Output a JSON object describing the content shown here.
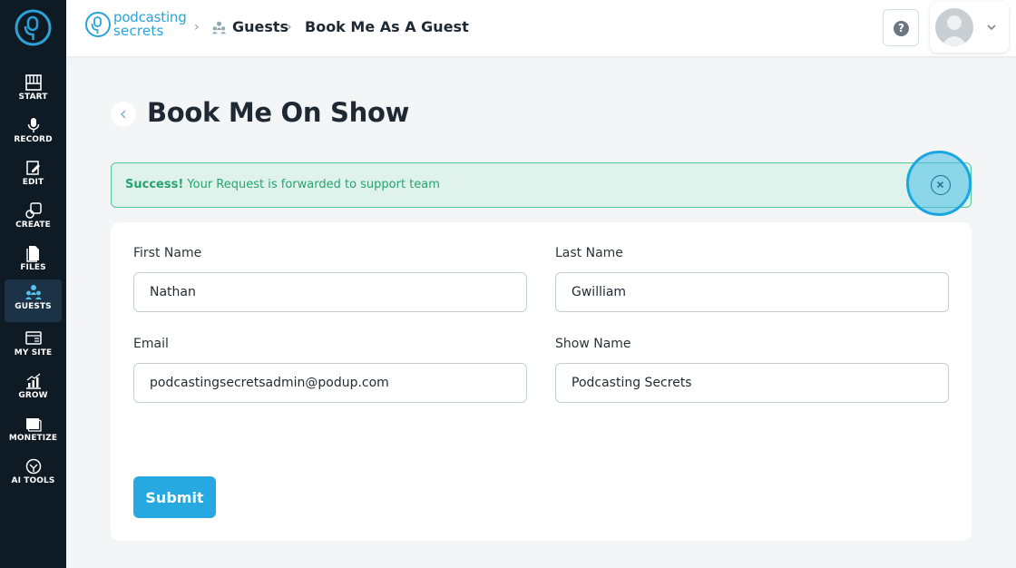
{
  "sidebar": {
    "items": [
      {
        "label": "START",
        "icon": "piano-icon"
      },
      {
        "label": "RECORD",
        "icon": "microphone-icon"
      },
      {
        "label": "EDIT",
        "icon": "edit-icon"
      },
      {
        "label": "CREATE",
        "icon": "create-icon"
      },
      {
        "label": "FILES",
        "icon": "files-icon"
      },
      {
        "label": "GUESTS",
        "icon": "guests-icon",
        "active": true
      },
      {
        "label": "MY SITE",
        "icon": "site-icon"
      },
      {
        "label": "GROW",
        "icon": "chart-icon"
      },
      {
        "label": "MONETIZE",
        "icon": "monetize-icon"
      },
      {
        "label": "AI TOOLS",
        "icon": "ai-icon"
      }
    ]
  },
  "header": {
    "brand_line1": "podcasting",
    "brand_line2": "secrets",
    "breadcrumb": [
      "Guests",
      "Book Me As A Guest"
    ]
  },
  "page": {
    "title": "Book Me On Show"
  },
  "alert": {
    "strong": "Success!",
    "message": "Your Request is forwarded to support team"
  },
  "form": {
    "first_name_label": "First Name",
    "first_name_value": "Nathan",
    "last_name_label": "Last Name",
    "last_name_value": "Gwilliam",
    "email_label": "Email",
    "email_value": "podcastingsecretsadmin@podup.com",
    "show_name_label": "Show Name",
    "show_name_value": "Podcasting Secrets",
    "submit_label": "Submit"
  },
  "colors": {
    "sidebar_bg": "#0e1a24",
    "accent": "#25a9e0",
    "success": "#27a36f"
  }
}
